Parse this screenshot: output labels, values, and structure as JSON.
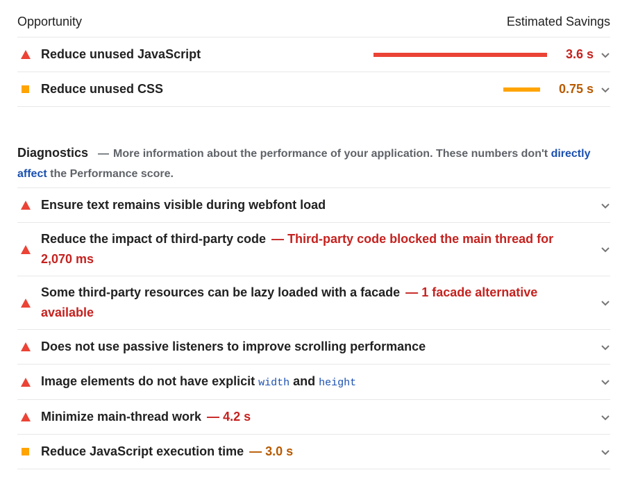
{
  "header": {
    "left": "Opportunity",
    "right": "Estimated Savings"
  },
  "opportunities": [
    {
      "icon": "triangle",
      "title": "Reduce unused JavaScript",
      "savings": "3.6 s",
      "bar_fraction": 1.0,
      "color": "#eb4335"
    },
    {
      "icon": "square",
      "title": "Reduce unused CSS",
      "savings": "0.75 s",
      "bar_fraction": 0.21,
      "color": "#ffa400"
    }
  ],
  "diagnostics": {
    "heading": "Diagnostics",
    "desc_before": "More information about the performance of your application. These numbers don't",
    "link": "directly affect",
    "desc_after": "the Performance score.",
    "items": [
      {
        "title": "Ensure text remains visible during webfont load"
      },
      {
        "title": "Reduce the impact of third-party code",
        "detail": "Third-party code blocked the main thread for 2,070 ms"
      },
      {
        "title": "Some third-party resources can be lazy loaded with a facade",
        "detail": "1 facade alternative available"
      },
      {
        "title": "Does not use passive listeners to improve scrolling performance"
      },
      {
        "title_a": "Image elements do not have explicit",
        "code_a": "width",
        "and": "and",
        "code_b": "height"
      },
      {
        "title": "Minimize main-thread work",
        "detail": "4.2 s"
      },
      {
        "title": "Reduce JavaScript execution time",
        "detail": "3.0 s"
      }
    ]
  },
  "dash": "—"
}
